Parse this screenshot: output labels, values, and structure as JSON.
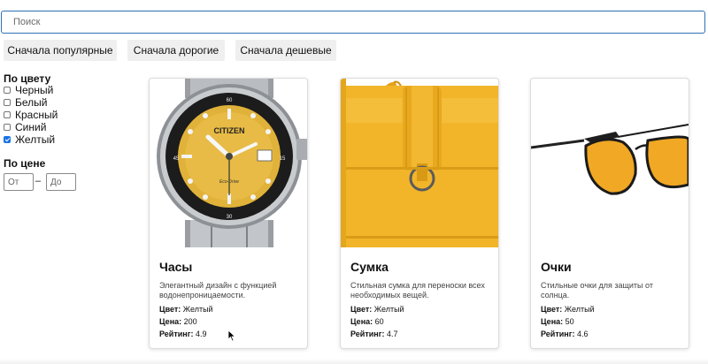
{
  "search": {
    "placeholder": "Поиск"
  },
  "sort": {
    "popular": "Сначала популярные",
    "expensive": "Сначала дорогие",
    "cheap": "Сначала дешевые"
  },
  "filters": {
    "color_title": "По цвету",
    "colors": [
      {
        "label": "Черный",
        "checked": false
      },
      {
        "label": "Белый",
        "checked": false
      },
      {
        "label": "Красный",
        "checked": false
      },
      {
        "label": "Синий",
        "checked": false
      },
      {
        "label": "Желтый",
        "checked": true
      }
    ],
    "price_title": "По цене",
    "price_from_placeholder": "От",
    "price_separator": "–",
    "price_to_placeholder": "До"
  },
  "labels": {
    "color": "Цвет:",
    "price": "Цена:",
    "rating": "Рейтинг:"
  },
  "products": [
    {
      "name": "Часы",
      "description": "Элегантный дизайн с функцией водонепроницаемости.",
      "color": "Желтый",
      "price": "200",
      "rating": "4.9",
      "image": "watch-image",
      "brand_text": "CITIZEN",
      "dial_text": "Eco-Drive"
    },
    {
      "name": "Сумка",
      "description": "Стильная сумка для переноски всех необходимых вещей.",
      "color": "Желтый",
      "price": "60",
      "rating": "4.7",
      "image": "bag-image"
    },
    {
      "name": "Очки",
      "description": "Стильные очки для защиты от солнца.",
      "color": "Желтый",
      "price": "50",
      "rating": "4.6",
      "image": "sunglasses-image"
    }
  ],
  "colors": {
    "search_border": "#2f6fb5",
    "button_bg": "#efefef",
    "product_yellow": "#f2b52a",
    "checkbox_checked": "#1a73e8"
  }
}
